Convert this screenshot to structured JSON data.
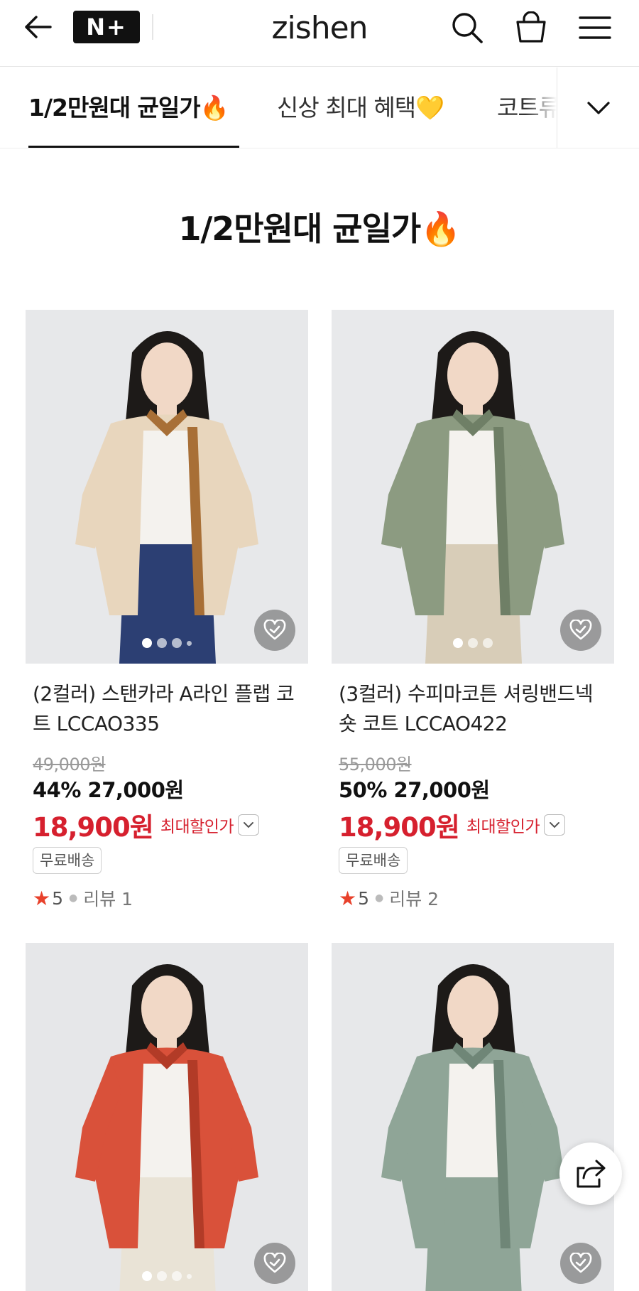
{
  "header": {
    "logo": "zishen",
    "nplus_label": "N+"
  },
  "tabs": [
    {
      "label": "1/2만원대 균일가🔥",
      "active": true
    },
    {
      "label": "신상 최대 혜택💛",
      "active": false
    },
    {
      "label": "코트류",
      "active": false
    }
  ],
  "section": {
    "title": "1/2만원대 균일가🔥"
  },
  "products": [
    {
      "name": "(2컬러) 스탠카라 A라인 플랩 코트 LCCAO335",
      "original_price": "49,000원",
      "discount": "44% 27,000원",
      "final_price": "18,900원",
      "final_label": "최대할인가",
      "badge": "무료배송",
      "rating": "5",
      "reviews": "리뷰 1",
      "image_dots": 4,
      "palette": {
        "bg": "#e7e8ea",
        "coat": "#e8d6bd",
        "accent": "#a86f36",
        "hair": "#1d1a18",
        "skin": "#f1d8c6",
        "pants": "#2c3f73"
      }
    },
    {
      "name": "(3컬러) 수피마코튼 셔링밴드넥 숏 코트 LCCAO422",
      "original_price": "55,000원",
      "discount": "50% 27,000원",
      "final_price": "18,900원",
      "final_label": "최대할인가",
      "badge": "무료배송",
      "rating": "5",
      "reviews": "리뷰 2",
      "image_dots": 3,
      "palette": {
        "bg": "#e8e9eb",
        "coat": "#8c9b81",
        "accent": "#6f7f66",
        "hair": "#1d1a18",
        "skin": "#f1d8c6",
        "pants": "#d8cdb8"
      }
    },
    {
      "name": "",
      "image_dots": 4,
      "palette": {
        "bg": "#e6e7e9",
        "coat": "#d9513a",
        "accent": "#b23b27",
        "hair": "#1d1a18",
        "skin": "#f1d8c6",
        "pants": "#e9e3d6"
      }
    },
    {
      "name": "",
      "image_dots": 0,
      "palette": {
        "bg": "#e7e8ea",
        "coat": "#8fa597",
        "accent": "#6f8677",
        "hair": "#1d1a18",
        "skin": "#f1d8c6",
        "pants": "#8fa597"
      }
    }
  ],
  "icons": {
    "back": "back-arrow-icon",
    "search": "search-icon",
    "bag": "shopping-bag-icon",
    "menu": "hamburger-menu-icon",
    "tabs_more": "chevron-down-icon",
    "wish": "heart-check-icon",
    "share": "share-icon"
  }
}
